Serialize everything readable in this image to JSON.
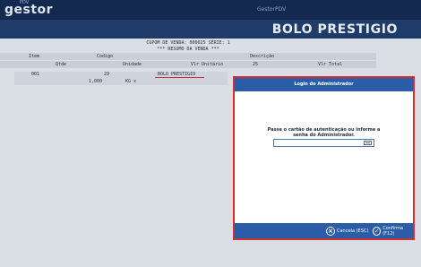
{
  "app": {
    "logo": "gestor",
    "logo_sup": "PDV",
    "title": "GestorPDV"
  },
  "store": {
    "name": "BOLO PRESTIGIO"
  },
  "receipt": {
    "header_line1": "CUPOM DE VENDA: 000025  SÉRIE: 1",
    "header_line2": "*** RESUMO DA VENDA ***",
    "columns1": {
      "item": "Item",
      "codigo": "Codigo",
      "descricao": "Descrição"
    },
    "columns2": {
      "qtde": "Qtde",
      "unidade": "Unidade",
      "vlr_unitario": "Vlr Unitário",
      "col4": "25",
      "vlr_total": "Vlr Total"
    },
    "line": {
      "item": "001",
      "codigo": "29",
      "descricao": "BOLO PRESTIGIO",
      "qtde": "1,000",
      "unidade": "KG x"
    }
  },
  "dialog": {
    "title": "Login do Administrador",
    "message_line1": "Passe o cartão de autenticação ou informe a",
    "message_line2": "senha do Administrador.",
    "input_value": "",
    "cancel_label": "Cancela (ESC)",
    "confirm_label": "Confirma (F12)"
  },
  "icons": {
    "card": "card-icon",
    "cancel": "x-circle-icon",
    "confirm": "check-circle-icon"
  },
  "colors": {
    "titlebar": "#13294f",
    "header": "#1f3c68",
    "dialog_bar": "#2a5ca8",
    "highlight_border": "#d32f2f"
  }
}
